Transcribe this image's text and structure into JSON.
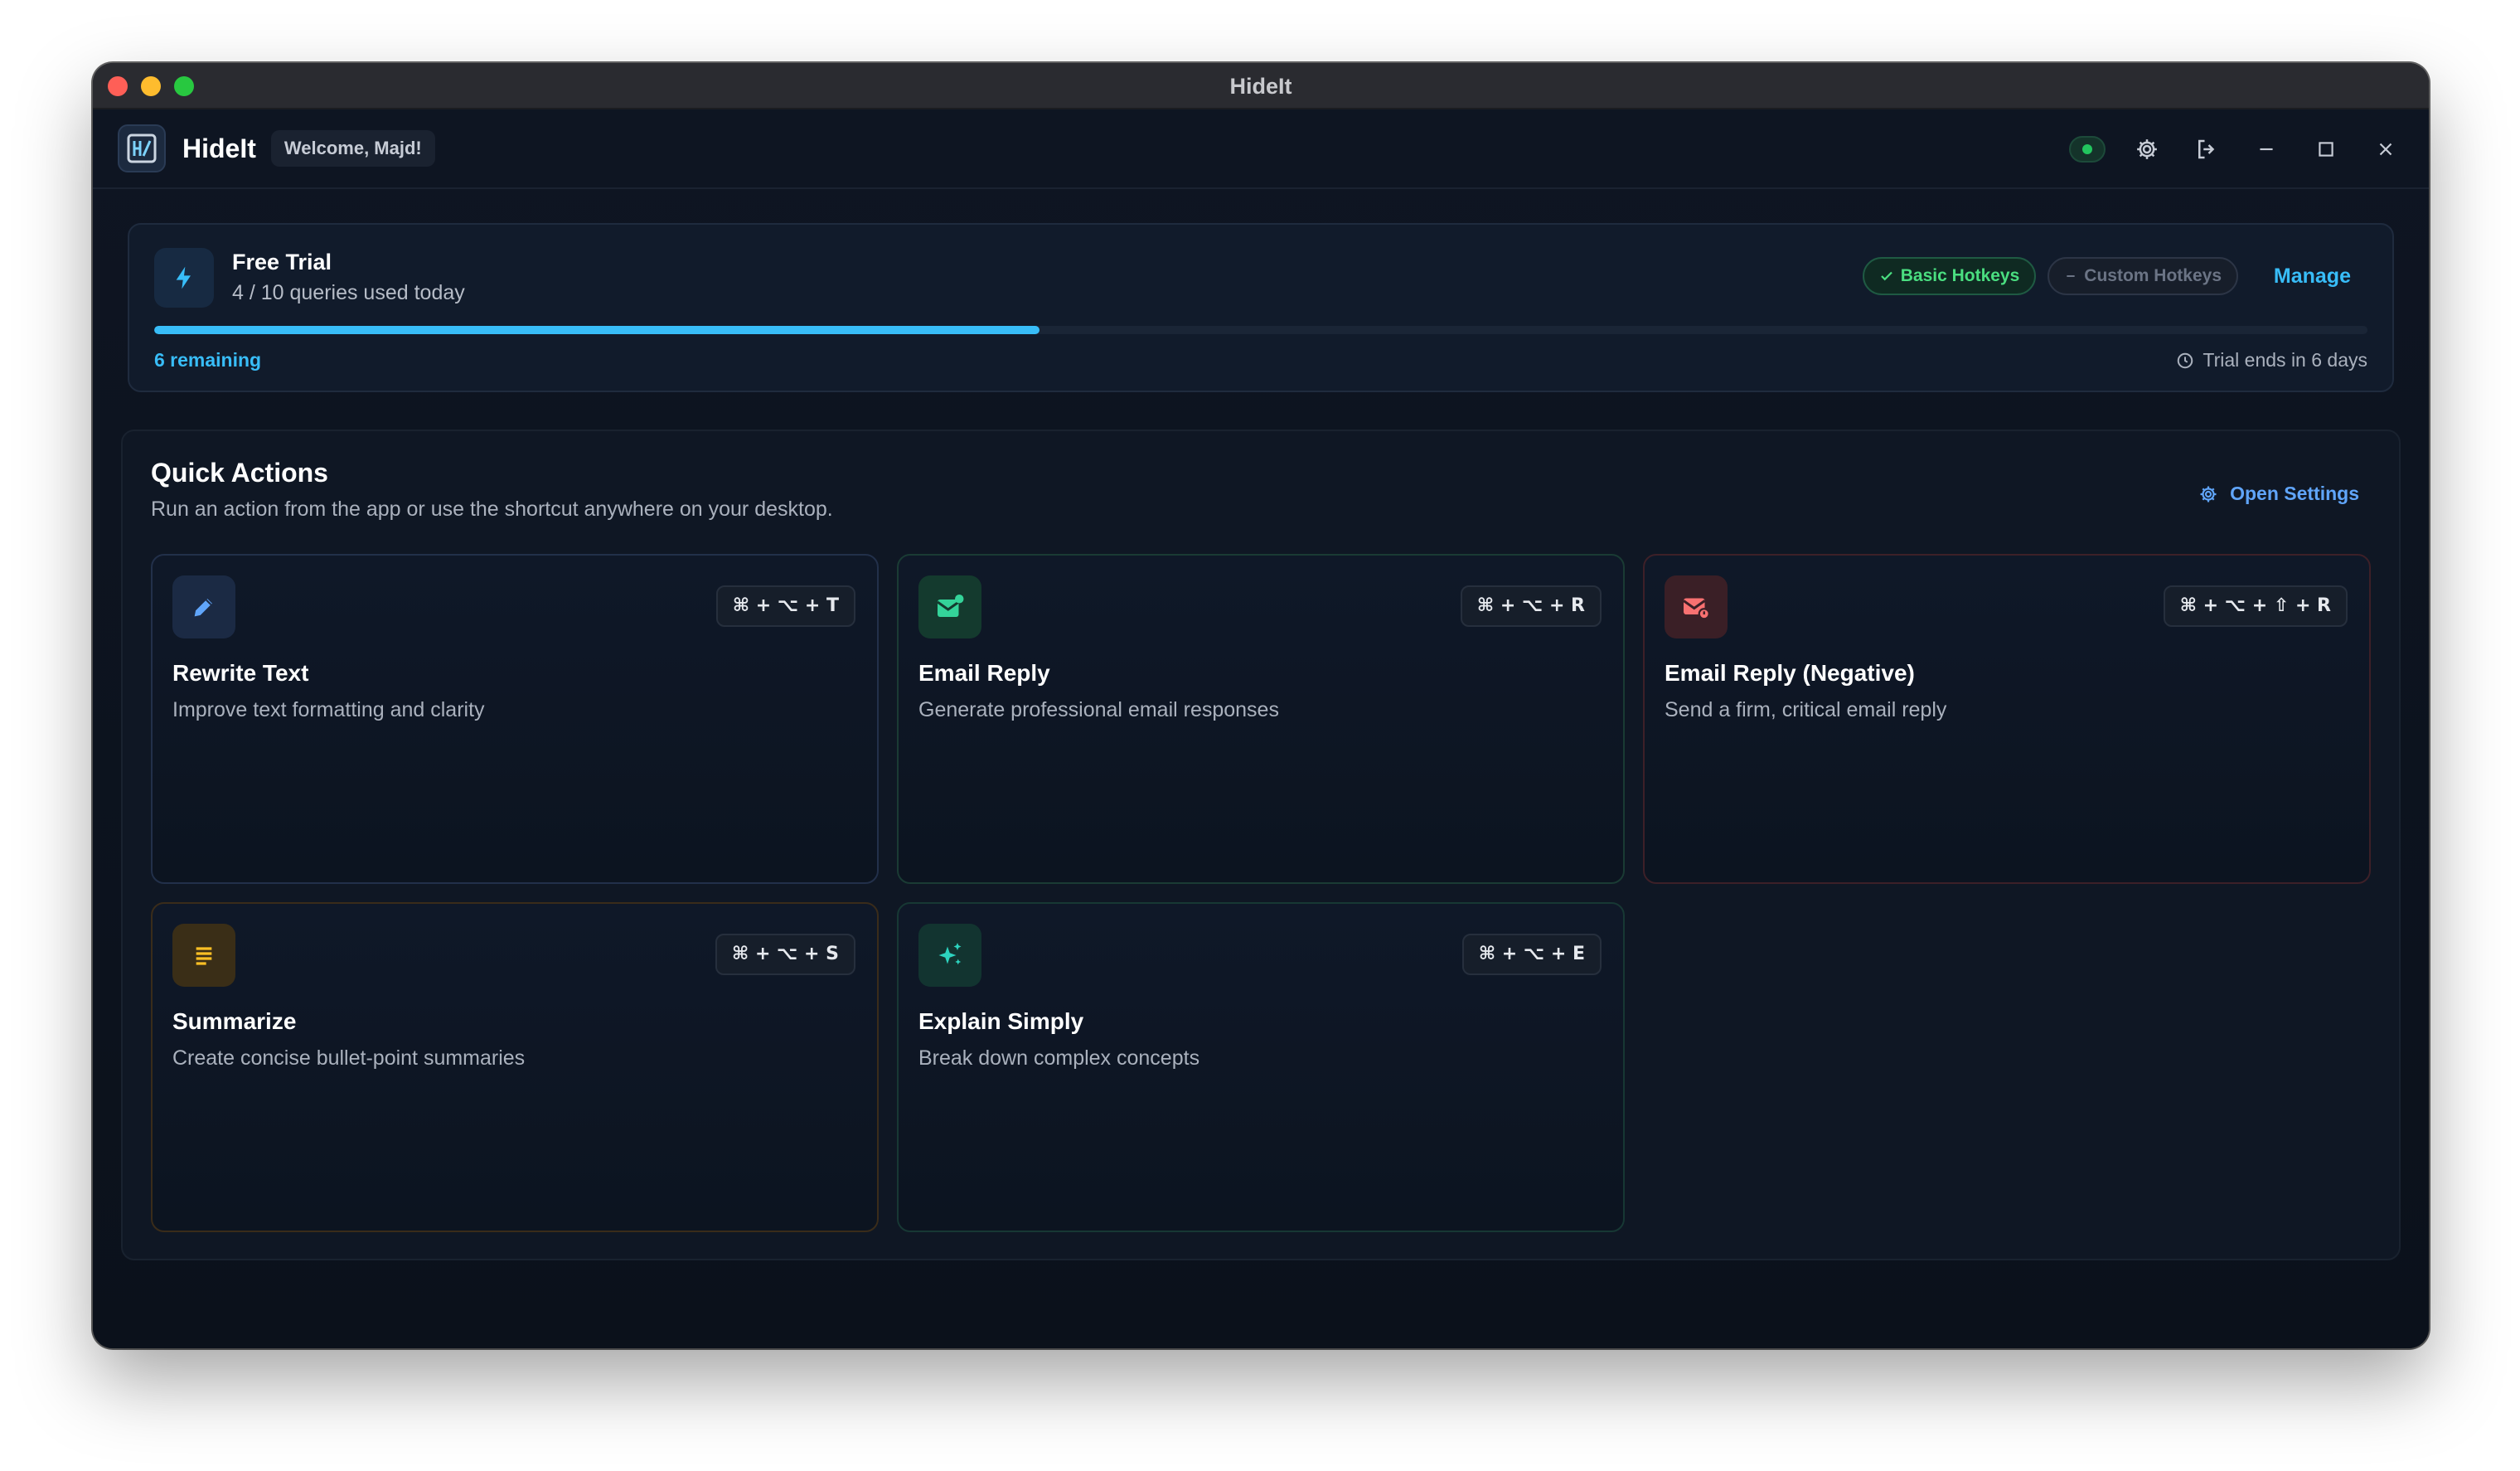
{
  "window": {
    "title": "HideIt"
  },
  "appbar": {
    "name": "HideIt",
    "welcome": "Welcome, Majd!"
  },
  "trial": {
    "title": "Free Trial",
    "usage": "4 / 10 queries used today",
    "progress_fraction": 0.4,
    "badges": {
      "basic": "Basic Hotkeys",
      "custom": "Custom Hotkeys"
    },
    "manage": "Manage",
    "remaining": "6 remaining",
    "ends": "Trial ends in 6 days"
  },
  "quick_actions": {
    "title": "Quick Actions",
    "subtitle": "Run an action from the app or use the shortcut anywhere on your desktop.",
    "open_settings": "Open Settings",
    "cards": [
      {
        "title": "Rewrite Text",
        "desc": "Improve text formatting and clarity",
        "shortcut": "⌘ + ⌥ + T",
        "icon": "pencil-icon",
        "color": "#60a5fa"
      },
      {
        "title": "Email Reply",
        "desc": "Generate professional email responses",
        "shortcut": "⌘ + ⌥ + R",
        "icon": "mail-check-icon",
        "color": "#34d399"
      },
      {
        "title": "Email Reply (Negative)",
        "desc": "Send a firm, critical email reply",
        "shortcut": "⌘ + ⌥ + ⇧ + R",
        "icon": "mail-warning-icon",
        "color": "#f87171"
      },
      {
        "title": "Summarize",
        "desc": "Create concise bullet-point summaries",
        "shortcut": "⌘ + ⌥ + S",
        "icon": "lines-icon",
        "color": "#fbbf24"
      },
      {
        "title": "Explain Simply",
        "desc": "Break down complex concepts",
        "shortcut": "⌘ + ⌥ + E",
        "icon": "sparkles-icon",
        "color": "#2dd4bf"
      }
    ]
  },
  "colors": {
    "accent": "#38bdf8",
    "success": "#22c55e",
    "background": "#0d1320"
  }
}
